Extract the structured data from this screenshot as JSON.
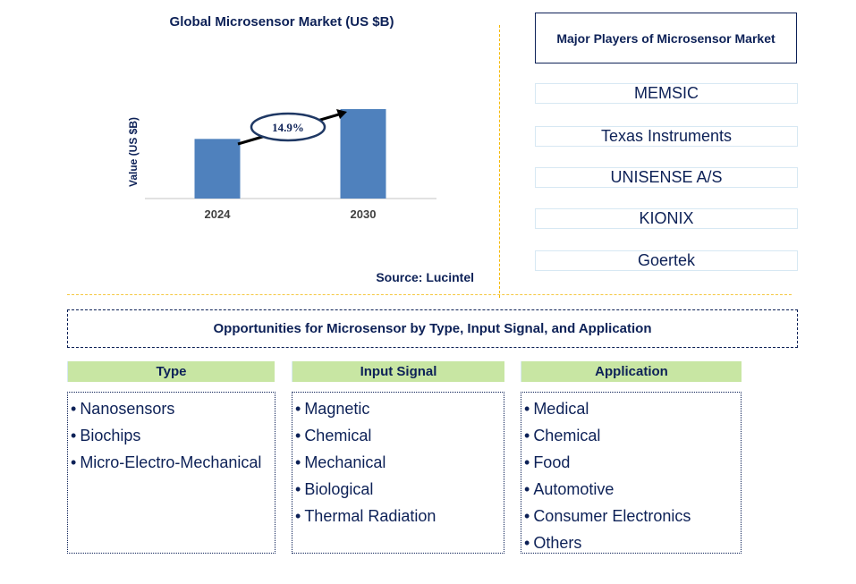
{
  "chart_data": {
    "type": "bar",
    "title": "Global Microsensor Market (US $B)",
    "xlabel": "",
    "ylabel": "Value (US $B)",
    "categories": [
      "2024",
      "2030"
    ],
    "values": [
      64,
      96
    ],
    "value_note": "relative bar heights; no numeric values shown",
    "annotation": "14.9%",
    "grid": false,
    "bar_color": "#4f81bd"
  },
  "source": "Source: Lucintel",
  "players": {
    "title": "Major Players of Microsensor Market",
    "items": [
      "MEMSIC",
      "Texas Instruments",
      "UNISENSE A/S",
      "KIONIX",
      "Goertek"
    ]
  },
  "opportunities": {
    "title": "Opportunities for Microsensor by Type, Input Signal, and Application",
    "bullet": "•",
    "columns": [
      {
        "header": "Type",
        "items": [
          "Nanosensors",
          "Biochips",
          "Micro-Electro-Mechanical"
        ]
      },
      {
        "header": "Input Signal",
        "items": [
          "Magnetic",
          "Chemical",
          "Mechanical",
          "Biological",
          "Thermal Radiation"
        ]
      },
      {
        "header": "Application",
        "items": [
          "Medical",
          "Chemical",
          "Food",
          "Automotive",
          "Consumer Electronics",
          "Others"
        ]
      }
    ]
  }
}
